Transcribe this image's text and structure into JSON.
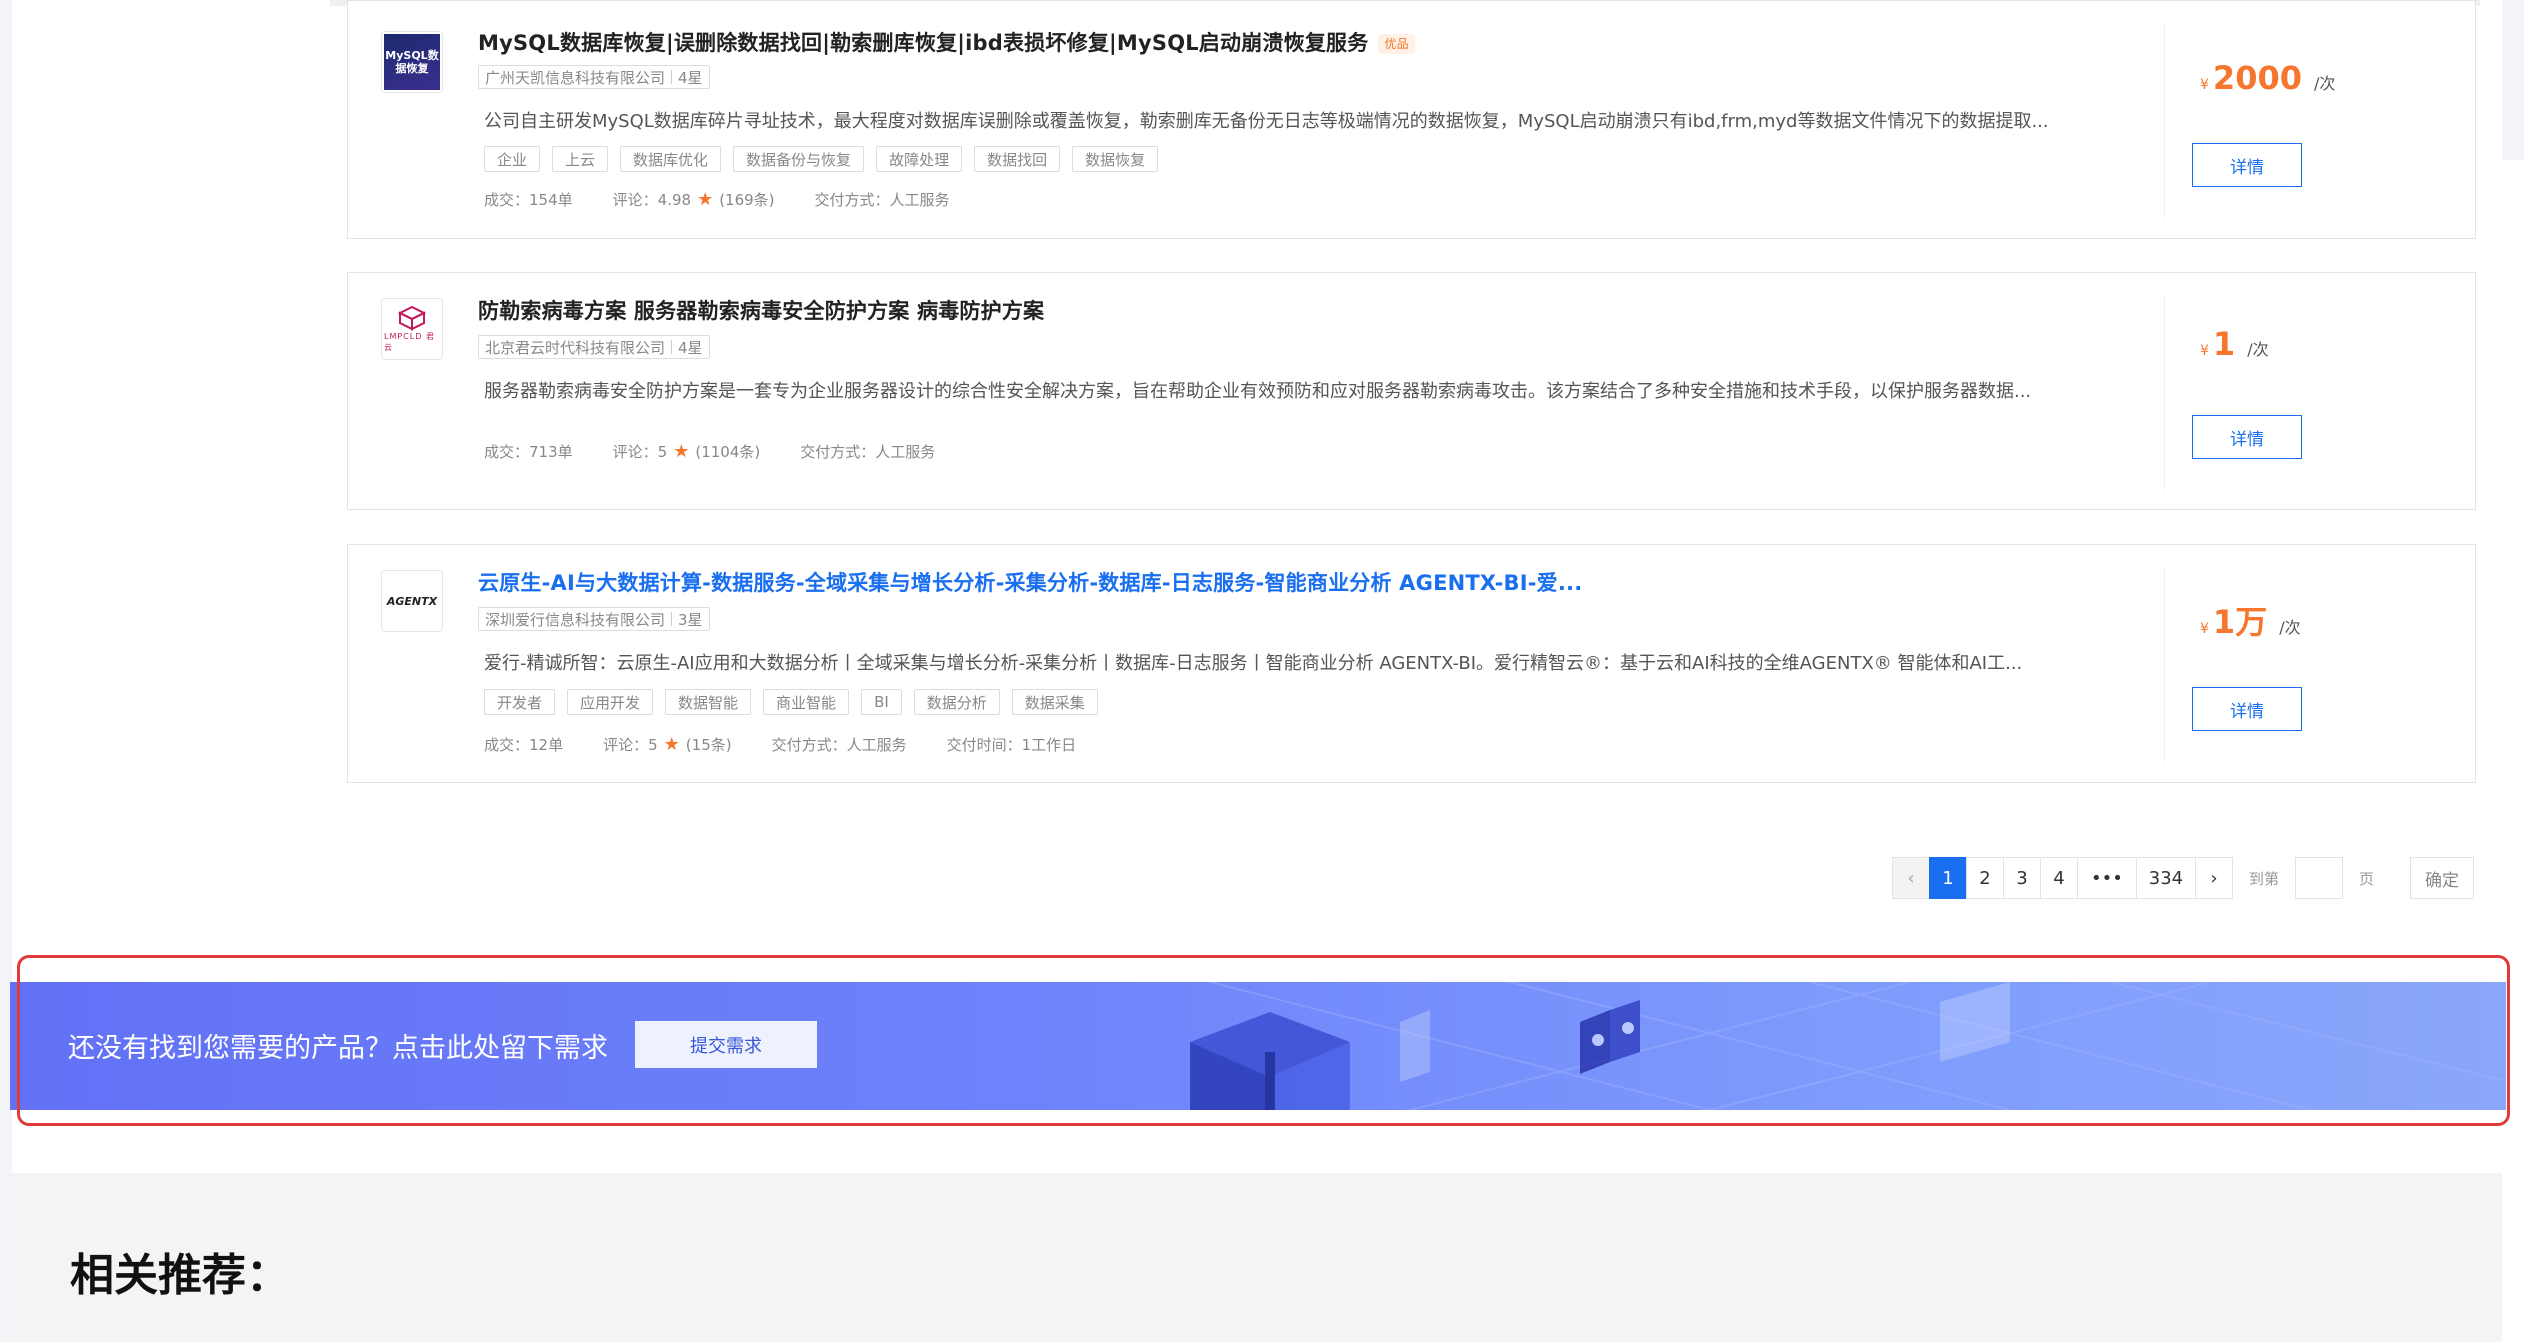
{
  "products": [
    {
      "title": "MySQL数据库恢复|误删除数据找回|勒索删库恢复|ibd表损坏修复|MySQL启动崩溃恢复服务",
      "badge": "优品",
      "logo_text": "MySQL数据恢复",
      "company": "广州天凯信息科技有限公司",
      "rating_level": "4星",
      "description": "公司自主研发MySQL数据库碎片寻址技术，最大程度对数据库误删除或覆盖恢复，勒索删库无备份无日志等极端情况的数据恢复，MySQL启动崩溃只有ibd,frm,myd等数据文件情况下的数据提取...",
      "tags": [
        "企业",
        "上云",
        "数据库优化",
        "数据备份与恢复",
        "故障处理",
        "数据找回",
        "数据恢复"
      ],
      "deals": "成交：154单",
      "review_label": "评论：",
      "review_score": "4.98",
      "review_count": "(169条)",
      "delivery": "交付方式：人工服务",
      "delivery_time": "",
      "currency": "¥",
      "price": "2000",
      "unit": "/次",
      "detail_label": "详情"
    },
    {
      "title": "防勒索病毒方案 服务器勒索病毒安全防护方案 病毒防护方案",
      "badge": "",
      "logo_text": "LMPCLD 君云",
      "company": "北京君云时代科技有限公司",
      "rating_level": "4星",
      "description": "服务器勒索病毒安全防护方案是一套专为企业服务器设计的综合性安全解决方案，旨在帮助企业有效预防和应对服务器勒索病毒攻击。该方案结合了多种安全措施和技术手段，以保护服务器数据...",
      "tags": [],
      "deals": "成交：713单",
      "review_label": "评论：",
      "review_score": "5",
      "review_count": "(1104条)",
      "delivery": "交付方式：人工服务",
      "delivery_time": "",
      "currency": "¥",
      "price": "1",
      "unit": "/次",
      "detail_label": "详情"
    },
    {
      "title": "云原生-AI与大数据计算-数据服务-全域采集与增长分析-采集分析-数据库-日志服务-智能商业分析 AGENTX-BI-爱...",
      "badge": "",
      "logo_text": "AGENTX",
      "company": "深圳爱行信息科技有限公司",
      "rating_level": "3星",
      "description": "爱行-精诚所智：云原生-AI应用和大数据分析丨全域采集与增长分析-采集分析丨数据库-日志服务丨智能商业分析 AGENTX-BI。爱行精智云®：基于云和AI科技的全维AGENTX® 智能体和AI工...",
      "tags": [
        "开发者",
        "应用开发",
        "数据智能",
        "商业智能",
        "BI",
        "数据分析",
        "数据采集"
      ],
      "deals": "成交：12单",
      "review_label": "评论：",
      "review_score": "5",
      "review_count": "(15条)",
      "delivery": "交付方式：人工服务",
      "delivery_time": "交付时间：1工作日",
      "currency": "¥",
      "price": "1万",
      "unit": "/次",
      "detail_label": "详情"
    }
  ],
  "pagination": {
    "prev": "‹",
    "pages": [
      "1",
      "2",
      "3",
      "4"
    ],
    "ellipsis": "•••",
    "last": "334",
    "next": "›",
    "goto_label": "到第",
    "page_label": "页",
    "confirm_label": "确定",
    "current_page": 1
  },
  "banner": {
    "text": "还没有找到您需要的产品？点击此处留下需求",
    "button": "提交需求"
  },
  "related": {
    "heading": "相关推荐："
  },
  "colors": {
    "accent": "#1a6ff0",
    "price": "#f5762c",
    "highlight_frame": "#e03a3a",
    "banner_start": "#6271f5",
    "banner_end": "#8aa7fb"
  }
}
